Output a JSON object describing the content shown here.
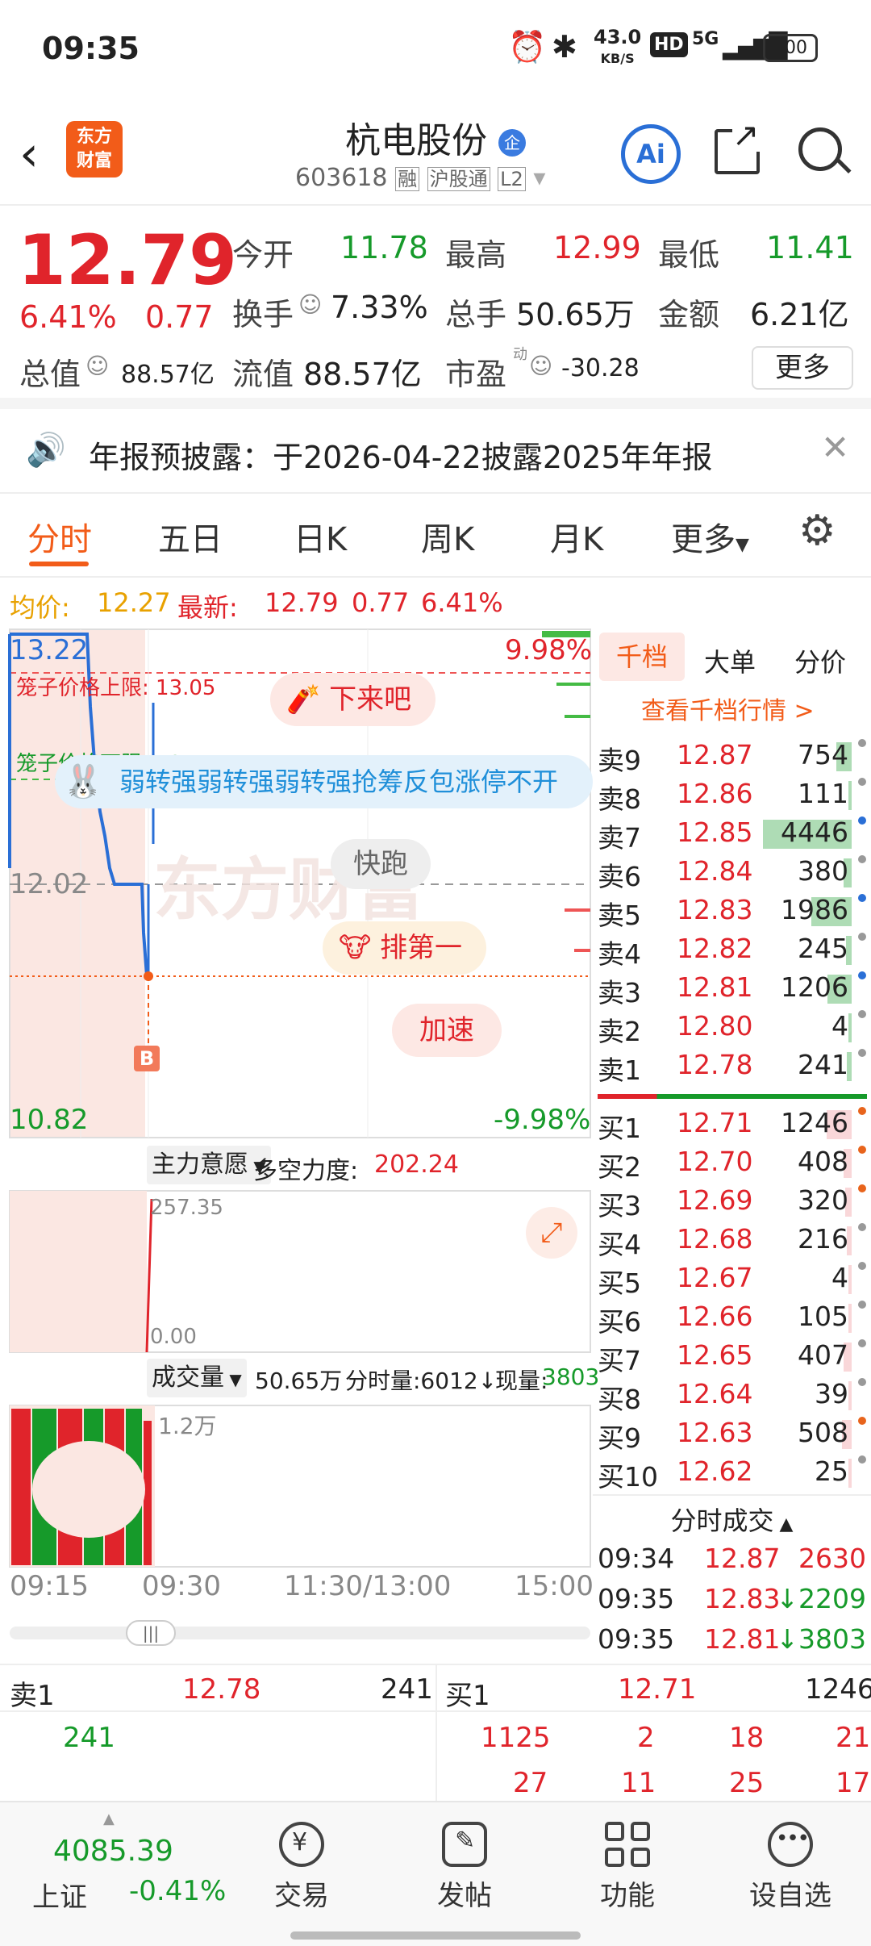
{
  "status": {
    "time": "09:35",
    "speed_value": "43.0",
    "speed_unit": "KB/S",
    "hd": "HD",
    "network": "5G",
    "battery": "100"
  },
  "header": {
    "title": "杭电股份",
    "badge": "企",
    "code": "603618",
    "tag_rong": "融",
    "tag_hgt": "沪股通",
    "tag_l2": "L2",
    "ai_label": "Ai"
  },
  "quote": {
    "price": "12.79",
    "pct": "6.41%",
    "change": "0.77",
    "open_label": "今开",
    "open": "11.78",
    "high_label": "最高",
    "high": "12.99",
    "low_label": "最低",
    "low": "11.41",
    "turnover_label": "换手",
    "turnover": "7.33%",
    "volume_label": "总手",
    "volume": "50.65万",
    "amount_label": "金额",
    "amount": "6.21亿",
    "mcap_label": "总值",
    "mcap": "88.57亿",
    "float_label": "流值",
    "float": "88.57亿",
    "pe_label": "市盈",
    "pe_sup": "动",
    "pe": "-30.28",
    "more_label": "更多"
  },
  "notice": {
    "text": "年报预披露：于2026-04-22披露2025年年报"
  },
  "tabs": [
    "分时",
    "五日",
    "日K",
    "周K",
    "月K",
    "更多"
  ],
  "avg": {
    "avg_label": "均价:",
    "avg": "12.27",
    "latest_label": "最新:",
    "latest": "12.79",
    "chg": "0.77",
    "pct": "6.41%"
  },
  "chart": {
    "y_top": "13.22",
    "y_mid": "12.02",
    "y_bottom": "10.82",
    "pct_top": "9.98%",
    "pct_bottom": "-9.98%",
    "cage_upper": "笼子价格上限: 13.05",
    "cage_lower": "笼子价格下限: 12.51",
    "bubble1": "下来吧",
    "bubble2": "快跑",
    "bubble3": "排第一",
    "bubble4": "加速",
    "marquee": "弱转强弱转强弱转强抢筹反包涨停不开",
    "watermark": "东方财富",
    "b_marker": "B",
    "ind_select": "主力意愿",
    "ind_label": "多空力度:",
    "ind_value": "202.24",
    "ind_top": "257.35",
    "ind_bottom": "0.00",
    "vol_select": "成交量",
    "vol_total": "50.65万",
    "vol_period": "分时量:6012↓",
    "vol_now_label": "现量:",
    "vol_now": "3803",
    "vol_axis": "1.2万",
    "times": [
      "09:15",
      "09:30",
      "11:30/13:00",
      "15:00"
    ],
    "scroll_handle": "|||"
  },
  "orderbook": {
    "tabs": [
      "千档",
      "大单",
      "分价"
    ],
    "link": "查看千档行情 >",
    "asks": [
      {
        "l": "卖9",
        "p": "12.87",
        "v": "754",
        "bar": 0.17,
        "dot": "#999"
      },
      {
        "l": "卖8",
        "p": "12.86",
        "v": "111",
        "bar": 0.03,
        "dot": "#999"
      },
      {
        "l": "卖7",
        "p": "12.85",
        "v": "4446",
        "bar": 1.0,
        "dot": "#2a6fd6"
      },
      {
        "l": "卖6",
        "p": "12.84",
        "v": "380",
        "bar": 0.09,
        "dot": "#999"
      },
      {
        "l": "卖5",
        "p": "12.83",
        "v": "1986",
        "bar": 0.45,
        "dot": "#2a6fd6"
      },
      {
        "l": "卖4",
        "p": "12.82",
        "v": "245",
        "bar": 0.06,
        "dot": "#999"
      },
      {
        "l": "卖3",
        "p": "12.81",
        "v": "1206",
        "bar": 0.27,
        "dot": "#2a6fd6"
      },
      {
        "l": "卖2",
        "p": "12.80",
        "v": "4",
        "bar": 0.01,
        "dot": "#999"
      },
      {
        "l": "卖1",
        "p": "12.78",
        "v": "241",
        "bar": 0.05,
        "dot": "#999"
      }
    ],
    "bids": [
      {
        "l": "买1",
        "p": "12.71",
        "v": "1246",
        "bar": 0.28,
        "dot": "#e8641c"
      },
      {
        "l": "买2",
        "p": "12.70",
        "v": "408",
        "bar": 0.09,
        "dot": "#e8641c"
      },
      {
        "l": "买3",
        "p": "12.69",
        "v": "320",
        "bar": 0.07,
        "dot": "#e8641c"
      },
      {
        "l": "买4",
        "p": "12.68",
        "v": "216",
        "bar": 0.05,
        "dot": "#999"
      },
      {
        "l": "买5",
        "p": "12.67",
        "v": "4",
        "bar": 0.01,
        "dot": "#999"
      },
      {
        "l": "买6",
        "p": "12.66",
        "v": "105",
        "bar": 0.02,
        "dot": "#999"
      },
      {
        "l": "买7",
        "p": "12.65",
        "v": "407",
        "bar": 0.09,
        "dot": "#999"
      },
      {
        "l": "买8",
        "p": "12.64",
        "v": "39",
        "bar": 0.01,
        "dot": "#999"
      },
      {
        "l": "买9",
        "p": "12.63",
        "v": "508",
        "bar": 0.11,
        "dot": "#e8641c"
      },
      {
        "l": "买10",
        "p": "12.62",
        "v": "25",
        "bar": 0.01,
        "dot": "#999"
      }
    ],
    "trades_title": "分时成交",
    "trades": [
      {
        "t": "09:34",
        "p": "12.87",
        "v": "2630",
        "dir": "",
        "c": "red"
      },
      {
        "t": "09:35",
        "p": "12.83",
        "v": "2209",
        "dir": "↓",
        "c": "green"
      },
      {
        "t": "09:35",
        "p": "12.81",
        "v": "3803",
        "dir": "↓",
        "c": "green"
      }
    ]
  },
  "bottom": {
    "sell_label": "卖1",
    "sell_price": "12.78",
    "sell_vol": "241",
    "sell_q": [
      "241"
    ],
    "buy_label": "买1",
    "buy_price": "12.71",
    "buy_vol": "1246",
    "buy_q1": [
      "1125",
      "2",
      "18",
      "21"
    ],
    "buy_q2": [
      "27",
      "11",
      "25",
      "17"
    ]
  },
  "nav": {
    "index_value": "4085.39",
    "index_name": "上证",
    "index_pct": "-0.41%",
    "items": [
      "交易",
      "发帖",
      "功能",
      "设自选"
    ]
  }
}
